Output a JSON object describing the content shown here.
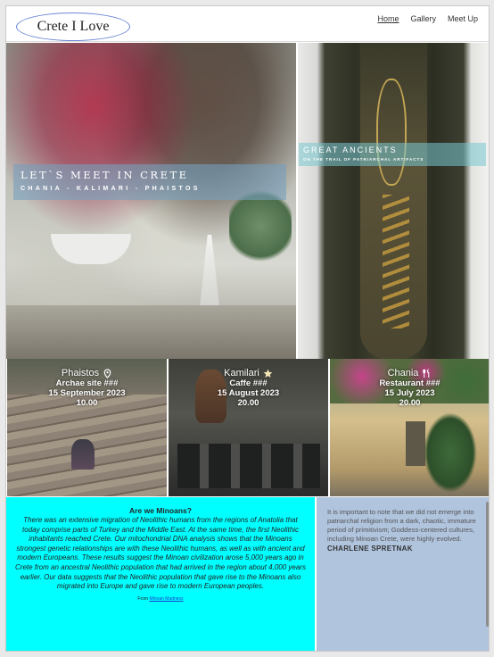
{
  "header": {
    "logo": "Crete I Love",
    "nav": [
      {
        "label": "Home"
      },
      {
        "label": "Gallery"
      },
      {
        "label": "Meet Up"
      }
    ]
  },
  "hero": {
    "left_title": "LET`S MEET IN CRETE",
    "left_subtitle": "CHANIA - KALIMARI - PHAISTOS",
    "right_title": "GREAT ANCIENTS",
    "right_subtitle": "ON THE TRAIL OF PATRIARCHAL ARTIFACTS"
  },
  "events": [
    {
      "city": "Phaistos",
      "icon": "map-pin-icon",
      "place": "Archae site ###",
      "date": "15 September 2023",
      "time": "10.00"
    },
    {
      "city": "Kamilari",
      "icon": "star-icon",
      "place": "Caffe ###",
      "date": "15 August 2023",
      "time": "20.00"
    },
    {
      "city": "Chania",
      "icon": "cutlery-icon",
      "place": "Restaurant ###",
      "date": "15 July 2023",
      "time": "20.00"
    }
  ],
  "article": {
    "question": "Are we Minoans?",
    "body": "There was an extensive migration of Neolithic humans from the regions of Anatolia that today comprise parts of Turkey and the Middle East. At the same time, the first Neolithic inhabitants reached Crete. Our mitochondrial DNA analysis shows that the Minoans strongest genetic relationships are with these Neolithic humans, as well as with ancient and modern Europeans. These results suggest the Minoan civilization arose 5,000 years ago in Crete from an ancestral Neolithic population that had arrived in the region about 4,000 years earlier. Our data suggests that the Neolithic population that gave rise to the Minoans also migrated into Europe and gave rise to modern European peoples.",
    "source_prefix": "From",
    "source_link": "Minoan Madness"
  },
  "quote": {
    "text": "It is important to note that we did not emerge into patriarchal religion from a dark, chaotic, immature period of primitivism; Goddess-centered cultures, including Minoan Crete, were highly evolved.",
    "author": "CHARLENE SPRETNAK"
  }
}
